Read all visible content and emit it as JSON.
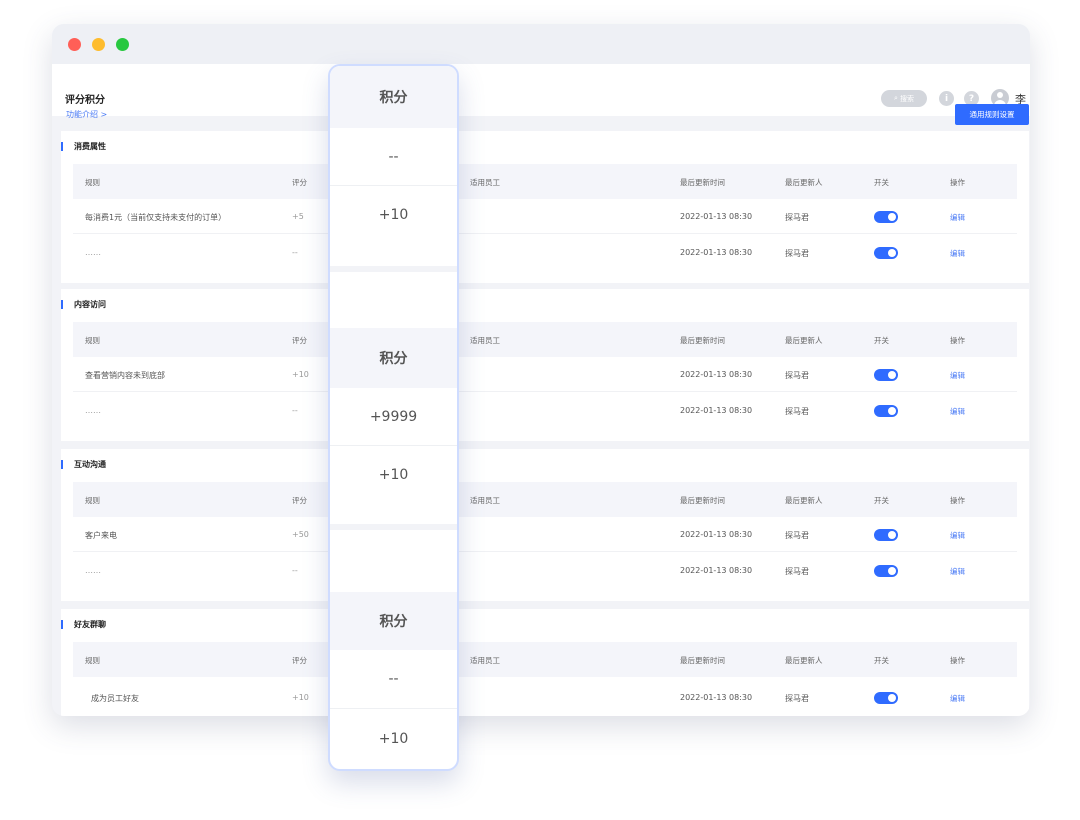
{
  "window": {
    "title": "评分积分"
  },
  "header": {
    "search_label": "搜索",
    "user_name": "李"
  },
  "subbar": {
    "feature_link": "功能介绍 >",
    "rule_button": "通用规则设置"
  },
  "columns": {
    "rule": "规则",
    "score": "评分",
    "employee": "适用员工",
    "updated_at": "最后更新时间",
    "updated_by": "最后更新人",
    "switch": "开关",
    "action": "操作"
  },
  "sections": [
    {
      "title": "消费属性",
      "rows": [
        {
          "rule": "每消费1元（当前仅支持未支付的订单）",
          "score": "+5",
          "time": "2022-01-13 08:30",
          "by": "探马君",
          "edit": "编辑",
          "enabled": true
        },
        {
          "rule": "……",
          "score": "--",
          "time": "2022-01-13 08:30",
          "by": "探马君",
          "edit": "编辑",
          "enabled": true
        }
      ]
    },
    {
      "title": "内容访问",
      "rows": [
        {
          "rule": "查看营销内容未到底部",
          "score": "+10",
          "time": "2022-01-13 08:30",
          "by": "探马君",
          "edit": "编辑",
          "enabled": true
        },
        {
          "rule": "……",
          "score": "--",
          "time": "2022-01-13 08:30",
          "by": "探马君",
          "edit": "编辑",
          "enabled": true
        }
      ]
    },
    {
      "title": "互动沟通",
      "rows": [
        {
          "rule": "客户来电",
          "score": "+50",
          "time": "2022-01-13 08:30",
          "by": "探马君",
          "edit": "编辑",
          "enabled": true
        },
        {
          "rule": "……",
          "score": "--",
          "time": "2022-01-13 08:30",
          "by": "探马君",
          "edit": "编辑",
          "enabled": true
        }
      ]
    },
    {
      "title": "好友群聊",
      "rows": [
        {
          "rule": "成为员工好友",
          "score": "+10",
          "time": "2022-01-13 08:30",
          "by": "探马君",
          "edit": "编辑",
          "enabled": true
        }
      ]
    }
  ],
  "floating_column": {
    "groups": [
      {
        "header": "积分",
        "values": [
          "--",
          "+10"
        ]
      },
      {
        "header": "积分",
        "values": [
          "+9999",
          "+10"
        ]
      },
      {
        "header": "积分",
        "values": [
          "--",
          "+10"
        ]
      }
    ]
  },
  "colors": {
    "accent": "#2f6bff",
    "link": "#4b7bf5",
    "window_bg": "#f2f3f7",
    "table_header_bg": "#f4f5fa"
  }
}
